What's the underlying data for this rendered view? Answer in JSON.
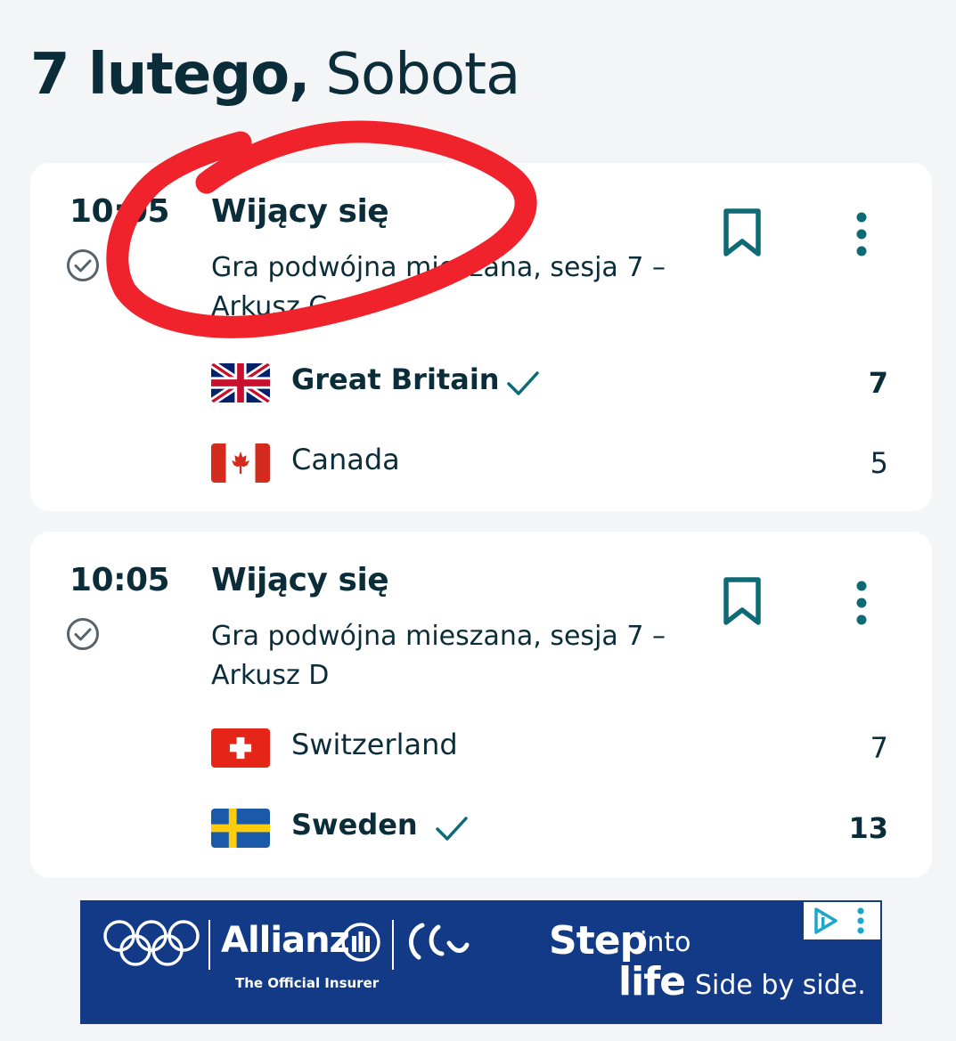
{
  "header": {
    "day": "7 lutego,",
    "weekday": "Sobota"
  },
  "events": [
    {
      "time": "10:05",
      "status_icon": "check-circle-icon",
      "title": "Wijący się",
      "description": "Gra podwójna mieszana, sesja 7 – Arkusz C",
      "teams": [
        {
          "name": "Great Britain",
          "score": "7",
          "winner": true,
          "flag": "great-britain-flag"
        },
        {
          "name": "Canada",
          "score": "5",
          "winner": false,
          "flag": "canada-flag"
        }
      ]
    },
    {
      "time": "10:05",
      "status_icon": "check-circle-icon",
      "title": "Wijący się",
      "description": "Gra podwójna mieszana, sesja 7 – Arkusz D",
      "teams": [
        {
          "name": "Switzerland",
          "score": "7",
          "winner": false,
          "flag": "switzerland-flag"
        },
        {
          "name": "Sweden",
          "score": "13",
          "winner": true,
          "flag": "sweden-flag"
        }
      ]
    }
  ],
  "ad": {
    "brand": "Allianz",
    "tagline": "The Official Insurer",
    "step": "Step",
    "into": "into",
    "life": "life",
    "side": "Side by side."
  },
  "colors": {
    "background": "#f4f5f6",
    "card": "#ffffff",
    "text": "#0b2d3a",
    "accent": "#0e6b75",
    "ad_background": "#123a86",
    "annotation": "#f0222b"
  }
}
